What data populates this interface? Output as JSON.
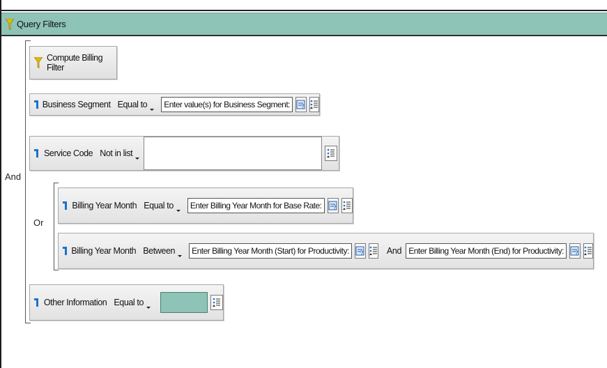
{
  "panel": {
    "title": "Query Filters",
    "header_color": "#8ec3b7"
  },
  "groups": {
    "outer_operator": "And",
    "inner_operator": "Or"
  },
  "compute_filter": {
    "label": "Compute Billing Filter"
  },
  "filters": [
    {
      "field": "Business Segment",
      "operator": "Equal to",
      "prompt": "Enter value(s) for Business Segment:"
    },
    {
      "field": "Service Code",
      "operator": "Not in list",
      "value": ""
    },
    {
      "field": "Billing Year Month",
      "operator": "Equal to",
      "prompt": "Enter Billing Year Month for Base Rate:"
    },
    {
      "field": "Billing Year Month",
      "operator": "Between",
      "prompt_start": "Enter Billing Year Month (Start) for Productivity:",
      "and_label": "And",
      "prompt_end": "Enter Billing Year Month (End) for Productivity:"
    },
    {
      "field": "Other Information",
      "operator": "Equal to",
      "value": ""
    }
  ],
  "icons": {
    "filter": "funnel-icon",
    "field": "field-object-icon",
    "prompt": "prompt-icon",
    "value_list": "value-list-icon"
  }
}
